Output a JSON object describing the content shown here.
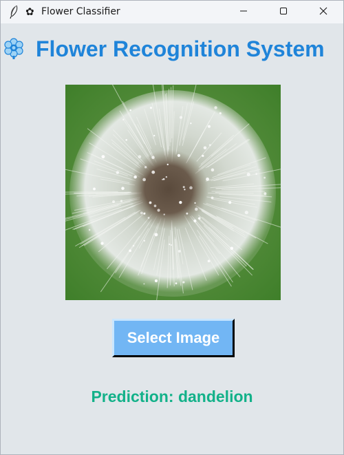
{
  "window": {
    "title": "Flower Classifier",
    "title_glyph": "✿",
    "app_icon": "feather-icon",
    "controls": {
      "minimize_icon": "minimize-icon",
      "maximize_icon": "maximize-icon",
      "close_icon": "close-icon"
    }
  },
  "header": {
    "icon": "flower-icon",
    "title": "Flower Recognition System"
  },
  "image_preview": {
    "subject": "dandelion seed head photo"
  },
  "actions": {
    "select_image_label": "Select Image"
  },
  "result": {
    "prediction_text": "Prediction: dandelion"
  },
  "colors": {
    "background": "#e1e6ea",
    "heading": "#1f84d9",
    "button": "#72b6f4",
    "prediction": "#12b189"
  }
}
